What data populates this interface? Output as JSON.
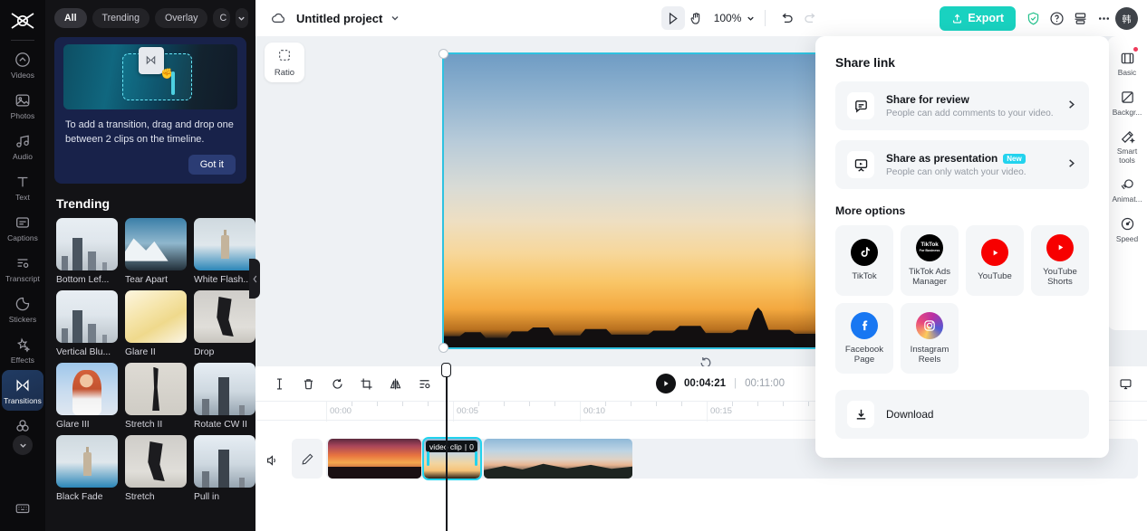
{
  "left_rail": {
    "logo": "capcut-logo",
    "items": [
      {
        "label": "Videos",
        "icon": "chevron-up-circle-icon",
        "active": false
      },
      {
        "label": "Photos",
        "icon": "image-icon",
        "active": false
      },
      {
        "label": "Audio",
        "icon": "music-note-icon",
        "active": false
      },
      {
        "label": "Text",
        "icon": "text-icon",
        "active": false
      },
      {
        "label": "Captions",
        "icon": "captions-icon",
        "active": false
      },
      {
        "label": "Transcript",
        "icon": "transcript-icon",
        "active": false
      },
      {
        "label": "Stickers",
        "icon": "sticker-icon",
        "active": false
      },
      {
        "label": "Effects",
        "icon": "sparkle-star-icon",
        "active": false
      },
      {
        "label": "Transitions",
        "icon": "transitions-icon",
        "active": true
      }
    ],
    "more_icon": "chevron-down-icon",
    "collab_icon": "people-circles-icon",
    "bottom_icon": "keyboard-icon"
  },
  "left_panel": {
    "chips": [
      {
        "label": "All",
        "active": true
      },
      {
        "label": "Trending",
        "active": false
      },
      {
        "label": "Overlay",
        "active": false
      },
      {
        "label": "C",
        "active": false
      }
    ],
    "chip_caret_icon": "chevron-down-icon",
    "promo": {
      "text": "To add a transition, drag and drop one between 2 clips on the timeline.",
      "button": "Got it",
      "card_icon": "transitions-icon",
      "cursor_icon": "hand-cursor-icon"
    },
    "section_title": "Trending",
    "transitions": [
      {
        "label": "Bottom Lef...",
        "art": "t-city"
      },
      {
        "label": "Tear Apart",
        "art": "t-mount"
      },
      {
        "label": "White Flash...",
        "art": "t-tower"
      },
      {
        "label": "Vertical Blu...",
        "art": "t-city"
      },
      {
        "label": "Glare II",
        "art": "t-glare"
      },
      {
        "label": "Drop",
        "art": "t-drop"
      },
      {
        "label": "Glare III",
        "art": "t-red"
      },
      {
        "label": "Stretch II",
        "art": "t-stretch"
      },
      {
        "label": "Rotate CW II",
        "art": "t-sky"
      },
      {
        "label": "Black Fade",
        "art": "t-tower"
      },
      {
        "label": "Stretch",
        "art": "t-drop"
      },
      {
        "label": "Pull in",
        "art": "t-sky"
      }
    ],
    "collapse_icon": "chevron-left-icon"
  },
  "topbar": {
    "cloud_icon": "cloud-icon",
    "project_title": "Untitled project",
    "title_caret_icon": "chevron-down-icon",
    "select_tool_icon": "cursor-arrow-icon",
    "hand_tool_icon": "hand-icon",
    "zoom_level": "100%",
    "zoom_caret_icon": "chevron-down-icon",
    "undo_icon": "undo-icon",
    "redo_icon": "redo-icon",
    "export_label": "Export",
    "export_icon": "upload-icon",
    "export_color": "#19d2c0",
    "shield_icon": "shield-check-icon",
    "help_icon": "question-circle-icon",
    "layout_icon": "layout-icon",
    "more_icon": "ellipsis-icon",
    "avatar_initial": "韩"
  },
  "preview": {
    "ratio_label": "Ratio",
    "ratio_icon": "crop-dashed-icon",
    "rotate_icon": "rotate-handle-icon",
    "selection_color": "#2fc2e0"
  },
  "timeline": {
    "tools": [
      {
        "name": "split",
        "icon": "split-icon"
      },
      {
        "name": "delete",
        "icon": "trash-icon"
      },
      {
        "name": "rotate",
        "icon": "rotate-icon"
      },
      {
        "name": "crop",
        "icon": "crop-icon"
      },
      {
        "name": "mirror",
        "icon": "mirror-icon"
      },
      {
        "name": "speed",
        "icon": "speed-icon"
      }
    ],
    "play_icon": "play-icon",
    "current_time": "00:04:21",
    "time_separator": "|",
    "total_time": "00:11:00",
    "right_tools": [
      {
        "name": "fit",
        "icon": "fit-icon"
      },
      {
        "name": "display",
        "icon": "monitor-icon"
      }
    ],
    "ruler_labels": [
      "00:00",
      "00:05",
      "00:10",
      "00:15"
    ],
    "mute_icon": "speaker-icon",
    "edit_icon": "pencil-icon",
    "selected_clip_label": "video clip",
    "selected_clip_extra": "0",
    "clips": [
      {
        "name": "clip-1"
      },
      {
        "name": "clip-2-selected"
      },
      {
        "name": "clip-3"
      }
    ]
  },
  "right_rail": {
    "items": [
      {
        "label": "Basic",
        "icon": "basic-icon",
        "badge": true
      },
      {
        "label": "Backgr...",
        "icon": "background-icon",
        "badge": false
      },
      {
        "label": "Smart tools",
        "icon": "magic-wand-icon",
        "badge": false
      },
      {
        "label": "Animat...",
        "icon": "animation-icon",
        "badge": false
      },
      {
        "label": "Speed",
        "icon": "speed-gauge-icon",
        "badge": false
      }
    ]
  },
  "share_panel": {
    "title": "Share link",
    "rows": [
      {
        "title": "Share for review",
        "subtitle": "People can add comments to your video.",
        "icon": "comment-box-icon",
        "badge": "",
        "chevron": "chevron-right-icon"
      },
      {
        "title": "Share as presentation",
        "subtitle": "People can only watch your video.",
        "icon": "presentation-icon",
        "badge": "New",
        "chevron": "chevron-right-icon"
      }
    ],
    "more_title": "More options",
    "options": [
      {
        "label": "TikTok",
        "icon": "tiktok-icon",
        "style": "soc-tiktok"
      },
      {
        "label": "TikTok Ads Manager",
        "icon": "tiktok-ads-icon",
        "style": "soc-tta"
      },
      {
        "label": "YouTube",
        "icon": "youtube-icon",
        "style": "soc-yt"
      },
      {
        "label": "YouTube Shorts",
        "icon": "youtube-shorts-icon",
        "style": "soc-yt"
      },
      {
        "label": "Facebook Page",
        "icon": "facebook-icon",
        "style": "soc-fb"
      },
      {
        "label": "Instagram Reels",
        "icon": "instagram-icon",
        "style": "soc-ig"
      }
    ],
    "download_label": "Download",
    "download_icon": "download-icon",
    "badge_color": "#22d3ee"
  }
}
